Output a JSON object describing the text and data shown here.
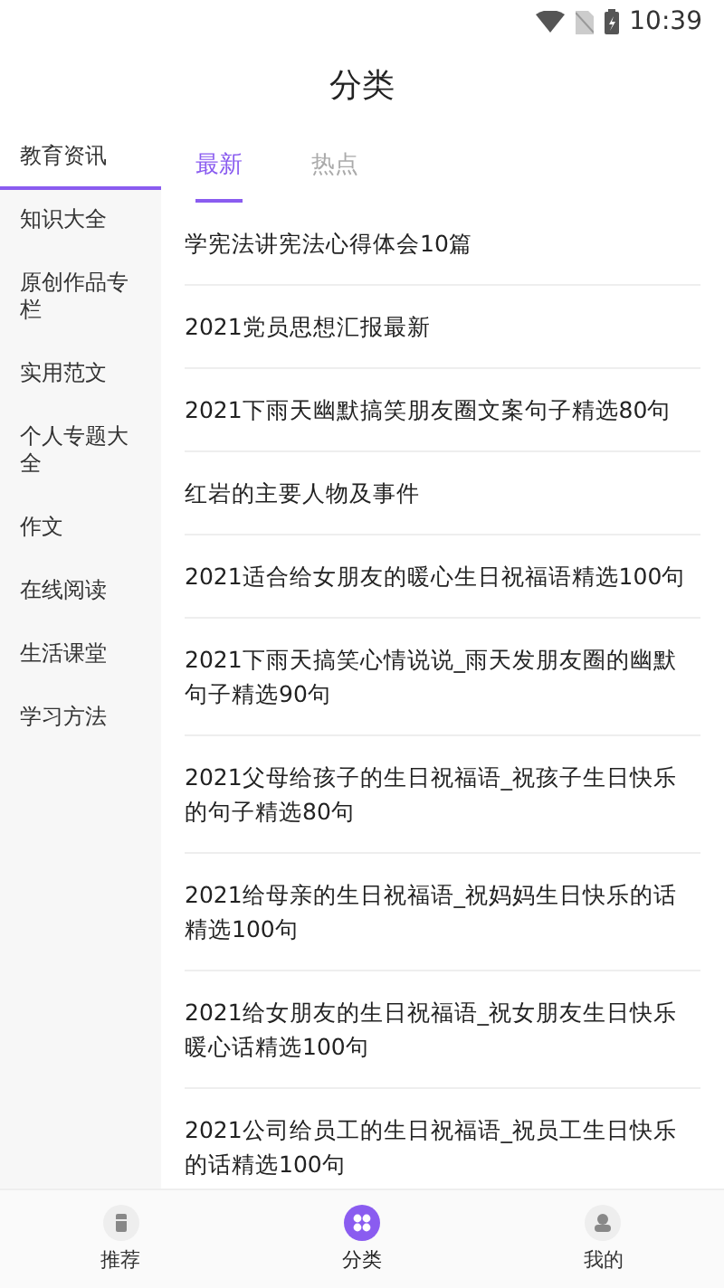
{
  "status_bar": {
    "time": "10:39"
  },
  "header": {
    "title": "分类"
  },
  "sidebar": {
    "items": [
      {
        "label": "教育资讯",
        "selected": true
      },
      {
        "label": "知识大全",
        "selected": false
      },
      {
        "label": "原创作品专栏",
        "selected": false
      },
      {
        "label": "实用范文",
        "selected": false
      },
      {
        "label": "个人专题大全",
        "selected": false
      },
      {
        "label": "作文",
        "selected": false
      },
      {
        "label": "在线阅读",
        "selected": false
      },
      {
        "label": "生活课堂",
        "selected": false
      },
      {
        "label": "学习方法",
        "selected": false
      }
    ]
  },
  "tabs": [
    {
      "label": "最新",
      "selected": true
    },
    {
      "label": "热点",
      "selected": false
    }
  ],
  "articles": [
    "学宪法讲宪法心得体会10篇",
    "2021党员思想汇报最新",
    "2021下雨天幽默搞笑朋友圈文案句子精选80句",
    "红岩的主要人物及事件",
    "2021适合给女朋友的暖心生日祝福语精选100句",
    "2021下雨天搞笑心情说说_雨天发朋友圈的幽默句子精选90句",
    "2021父母给孩子的生日祝福语_祝孩子生日快乐的句子精选80句",
    "2021给母亲的生日祝福语_祝妈妈生日快乐的话精选100句",
    "2021给女朋友的生日祝福语_祝女朋友生日快乐暖心话精选100句",
    "2021公司给员工的生日祝福语_祝员工生日快乐的话精选100句"
  ],
  "bottom_nav": [
    {
      "label": "推荐",
      "kind": "recommend",
      "selected": false
    },
    {
      "label": "分类",
      "kind": "category",
      "selected": true
    },
    {
      "label": "我的",
      "kind": "profile",
      "selected": false
    }
  ]
}
